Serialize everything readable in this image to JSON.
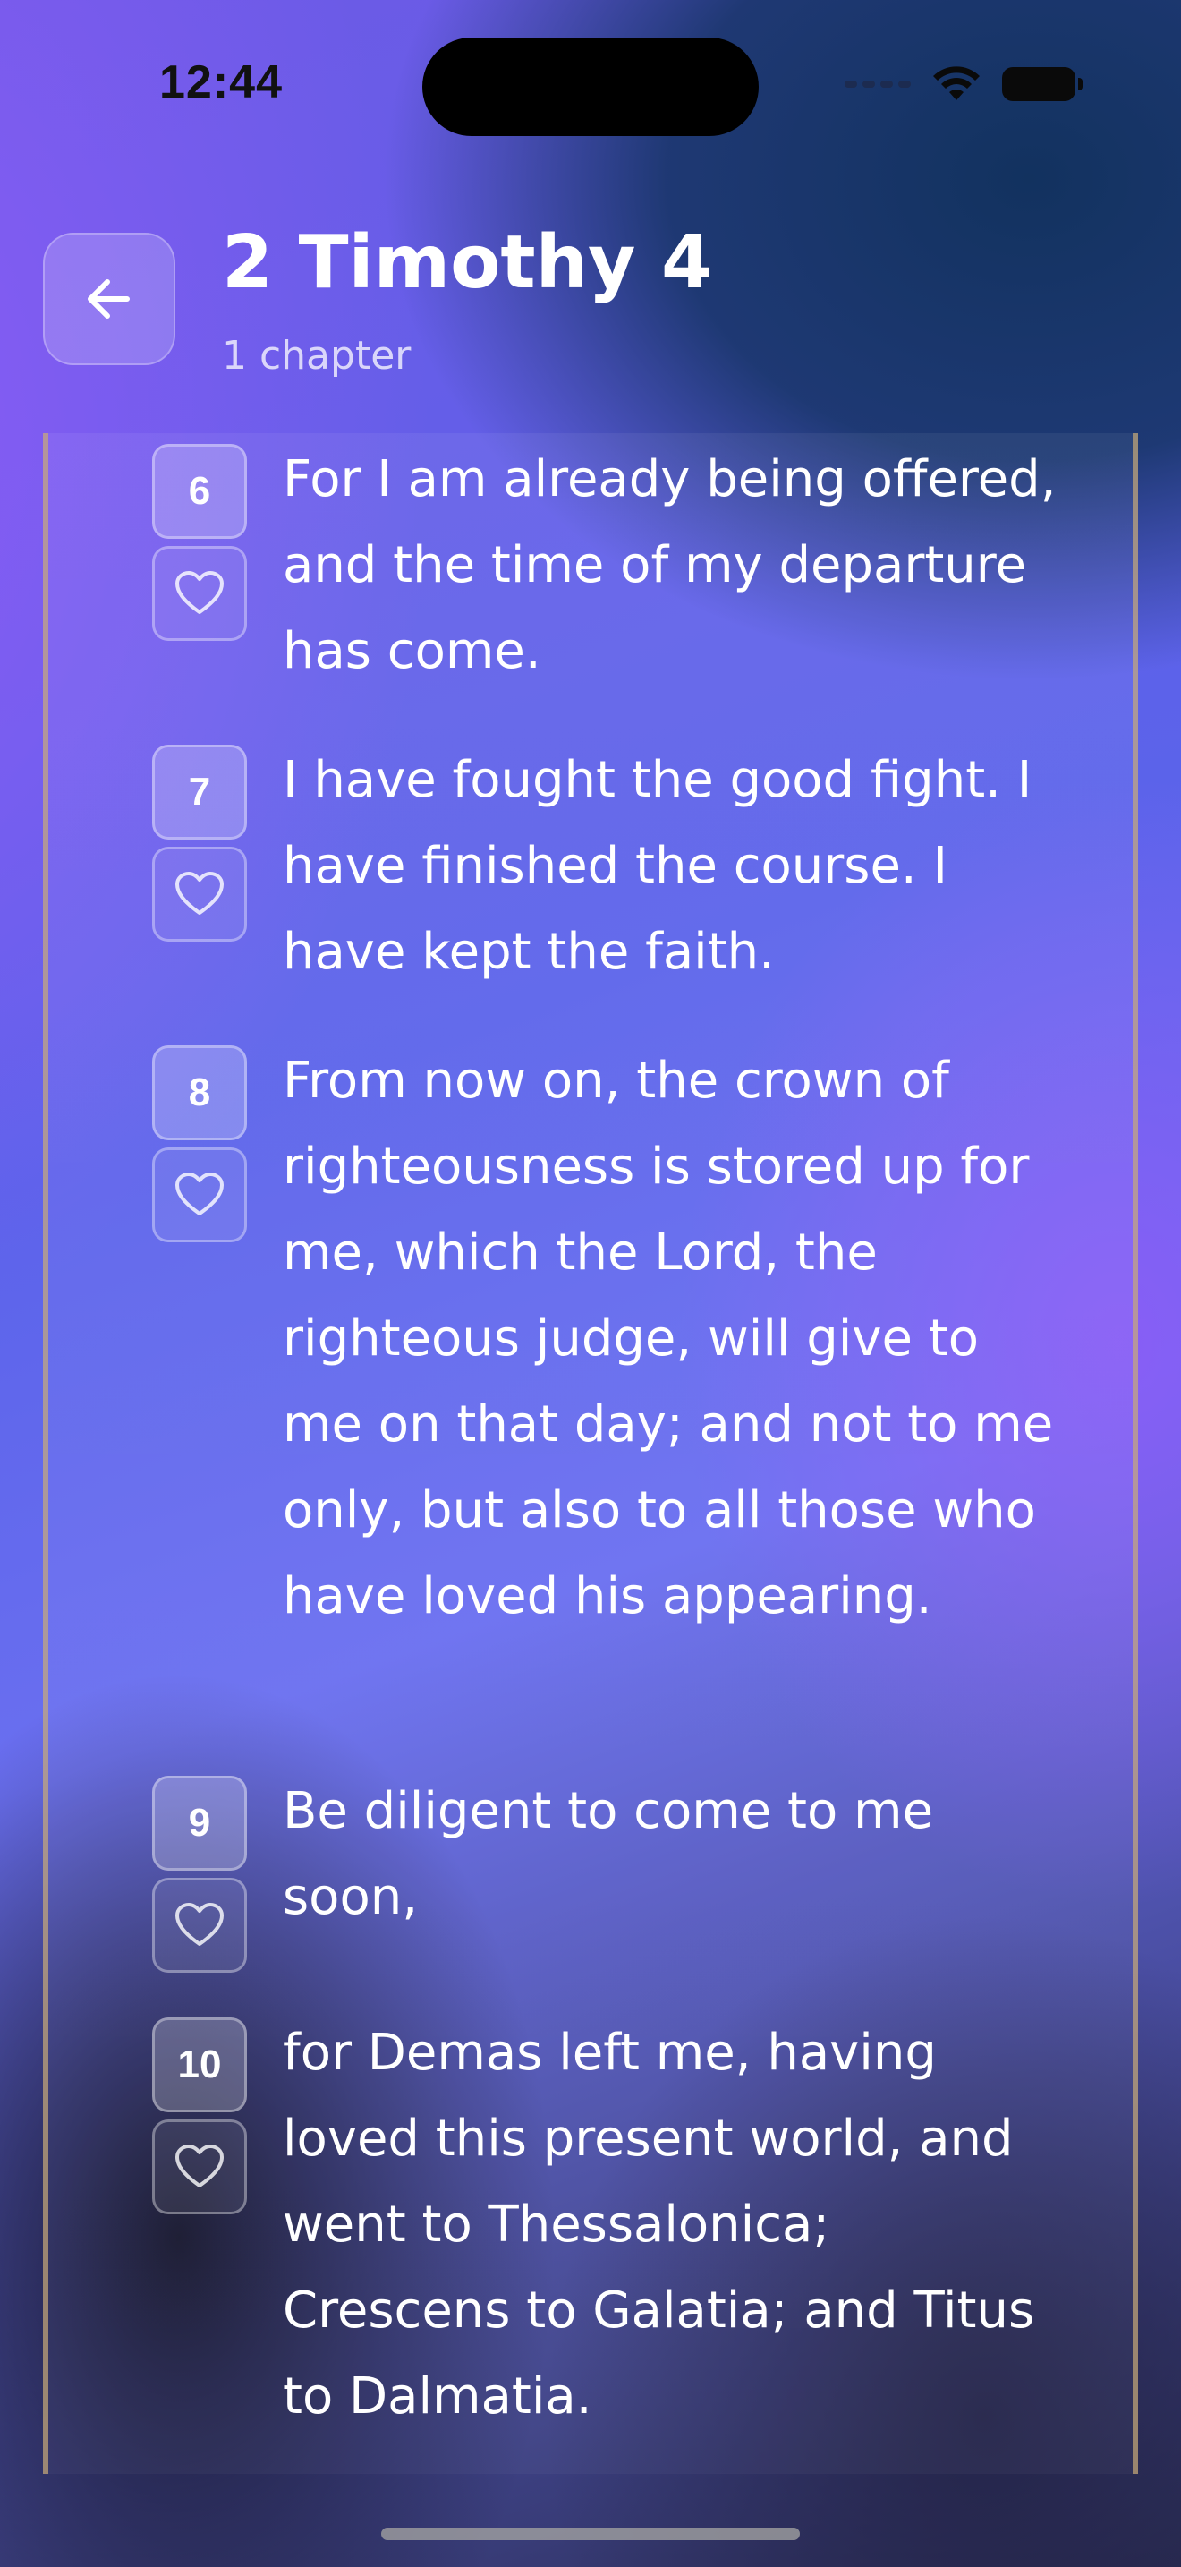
{
  "status_bar": {
    "time": "12:44"
  },
  "header": {
    "back_icon": "arrow-left-icon",
    "title": "2 Timothy 4",
    "subtitle": "1 chapter"
  },
  "verses": [
    {
      "number": "6",
      "text": "For I am already being offered, and the time of my departure has come."
    },
    {
      "number": "7",
      "text": "I have fought the good fight. I have finished the course. I have kept the faith."
    },
    {
      "number": "8",
      "text": "From now on, the crown of righteousness is stored up for me, which the Lord, the righteous judge, will give to me on that day; and not to me only, but also to all those who have loved his appearing."
    },
    {
      "number": "9",
      "text": "Be diligent to come to me soon,"
    },
    {
      "number": "10",
      "text": "for Demas left me, having loved this present world, and went to Thessalonica; Crescens to Galatia; and Titus to Dalmatia."
    }
  ],
  "colors": {
    "accent_purple": "#8b5cf6",
    "deep_navy": "#12325f",
    "text": "#ffffff"
  }
}
